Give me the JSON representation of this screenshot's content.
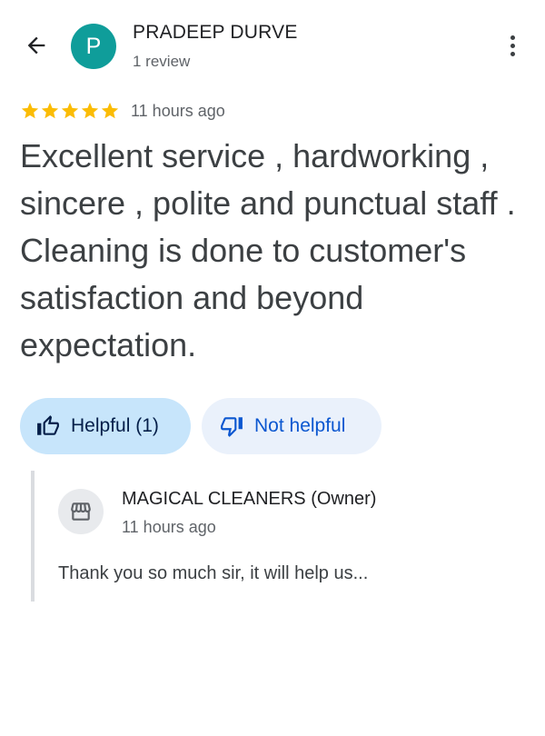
{
  "header": {
    "back_icon": "arrow-back-icon",
    "avatar_letter": "P",
    "avatar_color": "#0f9d9a",
    "reviewer_name": "PRADEEP DURVE",
    "review_count": "1 review",
    "more_icon": "more-vert-icon"
  },
  "review": {
    "rating": 5,
    "rating_max": 5,
    "star_color": "#fbbc04",
    "time_ago": "11 hours ago",
    "text": "Excellent service , hardworking , sincere , polite and punctual staff . Cleaning is done to customer's satisfaction and beyond expectation."
  },
  "actions": {
    "helpful_icon": "thumb-up-icon",
    "helpful_label": "Helpful (1)",
    "not_helpful_icon": "thumb-down-icon",
    "not_helpful_label": "Not helpful"
  },
  "owner_response": {
    "icon": "storefront-icon",
    "name": "MAGICAL CLEANERS (Owner)",
    "time_ago": "11 hours ago",
    "text": "Thank you so much sir, it will help us..."
  }
}
